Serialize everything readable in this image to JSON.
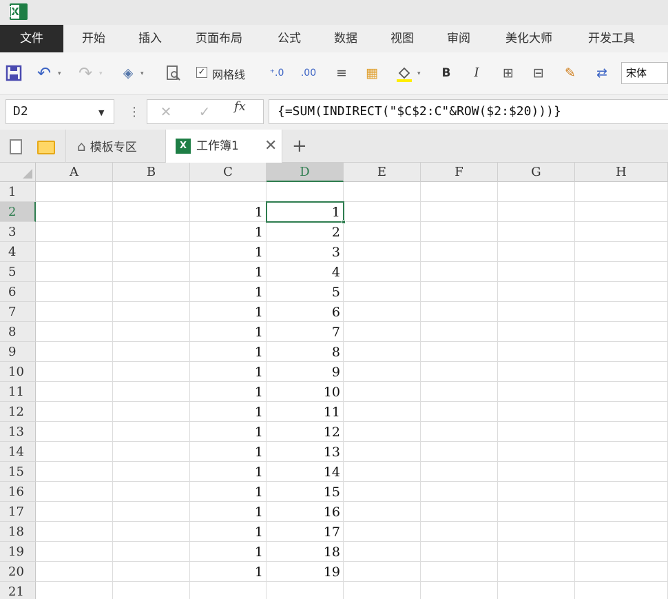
{
  "menu": [
    "文件",
    "开始",
    "插入",
    "页面布局",
    "公式",
    "数据",
    "视图",
    "审阅",
    "美化大师",
    "开发工具"
  ],
  "toolbar": {
    "gridlines_label": "网格线",
    "gridlines_checked": "✓",
    "font_name": "宋体",
    "bold": "B",
    "italic": "I"
  },
  "formula_bar": {
    "name_box": "D2",
    "formula": "{=SUM(INDIRECT(\"$C$2:C\"&ROW($2:$20)))}",
    "cancel": "✕",
    "confirm": "✓",
    "fx": "fx"
  },
  "tabs": {
    "home": "模板专区",
    "workbook": "工作簿1",
    "close": "✕",
    "add": "+"
  },
  "columns": [
    "A",
    "B",
    "C",
    "D",
    "E",
    "F",
    "G",
    "H"
  ],
  "rows": [
    "1",
    "2",
    "3",
    "4",
    "5",
    "6",
    "7",
    "8",
    "9",
    "10",
    "11",
    "12",
    "13",
    "14",
    "15",
    "16",
    "17",
    "18",
    "19",
    "20",
    "21"
  ],
  "cells": {
    "C": [
      "",
      "1",
      "1",
      "1",
      "1",
      "1",
      "1",
      "1",
      "1",
      "1",
      "1",
      "1",
      "1",
      "1",
      "1",
      "1",
      "1",
      "1",
      "1",
      "1"
    ],
    "D": [
      "",
      "1",
      "2",
      "3",
      "4",
      "5",
      "6",
      "7",
      "8",
      "9",
      "10",
      "11",
      "12",
      "13",
      "14",
      "15",
      "16",
      "17",
      "18",
      "19"
    ]
  },
  "selected": {
    "column": "D",
    "row": "2"
  },
  "colors": {
    "accent": "#2e7d4f",
    "menu_active": "#2b2b2b",
    "excel_green": "#1e7e45"
  }
}
